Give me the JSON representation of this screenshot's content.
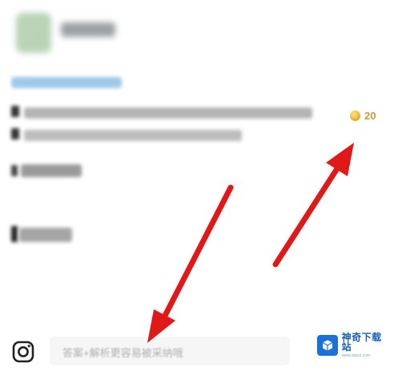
{
  "reward": {
    "icon": "coin-icon",
    "amount": "20",
    "color": "#c59a3a"
  },
  "bottom_bar": {
    "camera_icon": "camera-icon",
    "answer_placeholder": "答案+解析更容易被采纳哦"
  },
  "watermark": {
    "brand_name": "神奇下载站",
    "url": "www.sqxzz.com",
    "logo_color": "#1a72d8"
  },
  "annotation": {
    "arrow_color": "#e01818"
  }
}
